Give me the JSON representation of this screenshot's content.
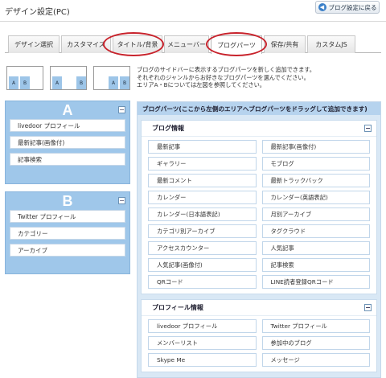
{
  "header": {
    "title": "デザイン設定(PC)",
    "back_button": "ブログ設定に戻る"
  },
  "tabs": [
    {
      "label": "デザイン選択"
    },
    {
      "label": "カスタマイズ"
    },
    {
      "label": "タイトル/背景"
    },
    {
      "label": "メニューバー"
    },
    {
      "label": "ブログパーツ"
    },
    {
      "label": "保存/共有"
    },
    {
      "label": "カスタムJS"
    }
  ],
  "layouts": [
    {
      "a": "A",
      "b": "B"
    },
    {
      "a": "A",
      "b": "B"
    },
    {
      "a": "A",
      "b": "B"
    }
  ],
  "description": {
    "line1": "ブログのサイドバーに表示するブログパーツを新しく追加できます。",
    "line2": "それぞれのジャンルからお好きなブログパーツを選んでください。",
    "line3": "エリアA・Bについては左図を参照してください。"
  },
  "area_a": {
    "letter": "A",
    "items": [
      "livedoor プロフィール",
      "最新記事(画像付)",
      "記事検索"
    ]
  },
  "area_b": {
    "letter": "B",
    "items": [
      "Twitter プロフィール",
      "カテゴリー",
      "アーカイブ"
    ]
  },
  "parts_panel": {
    "header": "ブログパーツ(ここから左側のエリアへブログパーツをドラッグして追加できます)",
    "groups": [
      {
        "title": "ブログ情報",
        "items": [
          "最新記事",
          "最新記事(画像付)",
          "ギャラリー",
          "モブログ",
          "最新コメント",
          "最新トラックバック",
          "カレンダー",
          "カレンダー(英語表記)",
          "カレンダー(日本語表記)",
          "月別アーカイブ",
          "カテゴリ別アーカイブ",
          "タグクラウド",
          "アクセスカウンター",
          "人気記事",
          "人気記事(画像付)",
          "記事検索",
          "QRコード",
          "LINE読者登録QRコード"
        ]
      },
      {
        "title": "プロフィール情報",
        "items": [
          "livedoor プロフィール",
          "Twitter プロフィール",
          "メンバーリスト",
          "参加中のブログ",
          "Skype Me",
          "メッセージ"
        ]
      }
    ]
  },
  "colors": {
    "area_blue": "#9fc7ea",
    "highlight_red": "#c8232c",
    "accent_blue": "#3a7fc8"
  }
}
